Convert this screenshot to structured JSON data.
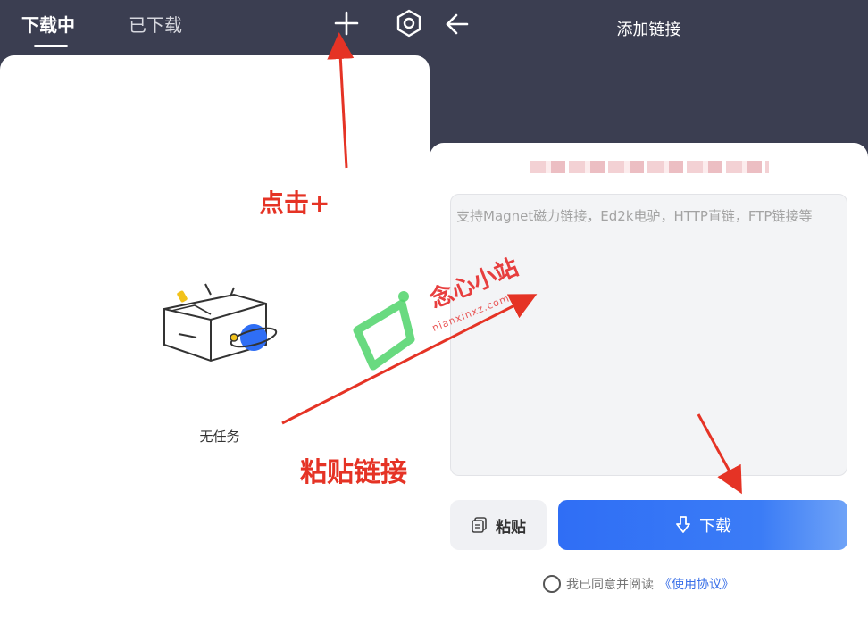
{
  "left": {
    "tabs": [
      {
        "label": "下载中",
        "active": true
      },
      {
        "label": "已下载",
        "active": false
      }
    ],
    "add_icon": "plus-icon",
    "settings_icon": "gear-icon",
    "empty_text": "无任务"
  },
  "right": {
    "title": "添加链接",
    "back_icon": "arrow-left-icon",
    "input": {
      "value": "",
      "placeholder": "支持Magnet磁力链接，Ed2k电驴，HTTP直链，FTP链接等"
    },
    "paste_label": "粘贴",
    "download_label": "下载",
    "agree_text": "我已同意并阅读",
    "agree_link": "《使用协议》"
  },
  "annotations": {
    "click_hint": "点击+",
    "paste_hint": "粘贴链接"
  },
  "watermark": {
    "text": "念心小站",
    "sub": "nianxinxz.com"
  },
  "colors": {
    "header_bg": "#3b3e51",
    "accent_blue": "#2f6ef5",
    "annotation_red": "#e53325"
  }
}
